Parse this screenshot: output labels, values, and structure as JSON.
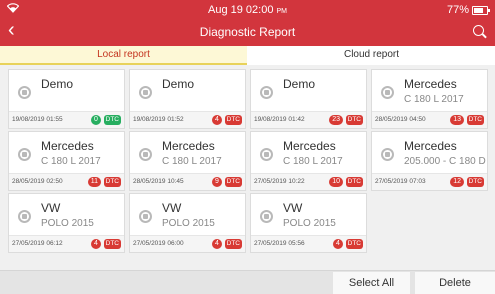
{
  "status": {
    "time": "Aug 19 02:00",
    "meridiem": "PM",
    "battery": "77%",
    "battery_level": 0.77
  },
  "header": {
    "title": "Diagnostic Report"
  },
  "tabs": [
    {
      "label": "Local report",
      "active": true
    },
    {
      "label": "Cloud report",
      "active": false
    }
  ],
  "dtc_label": "DTC",
  "reports": [
    {
      "name": "Demo",
      "model": "",
      "date": "19/08/2019 01:55",
      "count": "0",
      "status": "green"
    },
    {
      "name": "Demo",
      "model": "",
      "date": "19/08/2019 01:52",
      "count": "4",
      "status": "red"
    },
    {
      "name": "Demo",
      "model": "",
      "date": "19/08/2019 01:42",
      "count": "23",
      "status": "red"
    },
    {
      "name": "Mercedes",
      "model": "C 180 L 2017",
      "date": "28/05/2019 04:50",
      "count": "13",
      "status": "red"
    },
    {
      "name": "Mercedes",
      "model": "C 180 L 2017",
      "date": "28/05/2019 02:50",
      "count": "11",
      "status": "red"
    },
    {
      "name": "Mercedes",
      "model": "C 180 L 2017",
      "date": "28/05/2019 10:45",
      "count": "9",
      "status": "red"
    },
    {
      "name": "Mercedes",
      "model": "C 180 L 2017",
      "date": "27/05/2019 10:22",
      "count": "10",
      "status": "red"
    },
    {
      "name": "Mercedes",
      "model": "205.000 - C 180 D",
      "date": "27/05/2019 07:03",
      "count": "12",
      "status": "red"
    },
    {
      "name": "VW",
      "model": "POLO 2015",
      "date": "27/05/2019 06:12",
      "count": "4",
      "status": "red"
    },
    {
      "name": "VW",
      "model": "POLO 2015",
      "date": "27/05/2019 06:00",
      "count": "4",
      "status": "red"
    },
    {
      "name": "VW",
      "model": "POLO 2015",
      "date": "27/05/2019 05:56",
      "count": "4",
      "status": "red"
    }
  ],
  "colors": {
    "accent": "#d2353d",
    "ok": "#27ae60",
    "error": "#d83a34",
    "tab_active_bg": "#fdf8d6"
  },
  "actions": {
    "select_all": "Select All",
    "delete": "Delete"
  }
}
